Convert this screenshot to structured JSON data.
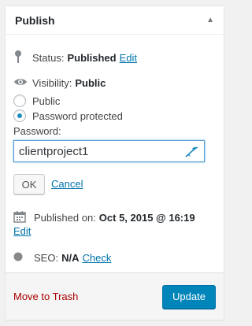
{
  "header": {
    "title": "Publish"
  },
  "status": {
    "label": "Status:",
    "value": "Published",
    "edit": "Edit"
  },
  "visibility": {
    "label": "Visibility:",
    "value": "Public",
    "options": [
      {
        "label": "Public",
        "checked": false
      },
      {
        "label": "Password protected",
        "checked": true
      }
    ],
    "password_label": "Password:",
    "password_value": "clientproject1",
    "ok": "OK",
    "cancel": "Cancel"
  },
  "published": {
    "label": "Published on:",
    "value": "Oct 5, 2015 @ 16:19",
    "edit": "Edit"
  },
  "seo": {
    "label": "SEO:",
    "value": "N/A",
    "check": "Check"
  },
  "footer": {
    "trash": "Move to Trash",
    "update": "Update"
  },
  "colors": {
    "accent": "#0085ba",
    "link": "#0073aa",
    "danger": "#a00"
  },
  "icons": [
    "pin-icon",
    "eye-icon",
    "key-icon",
    "calendar-icon",
    "seo-status-icon",
    "caret-up-icon"
  ]
}
